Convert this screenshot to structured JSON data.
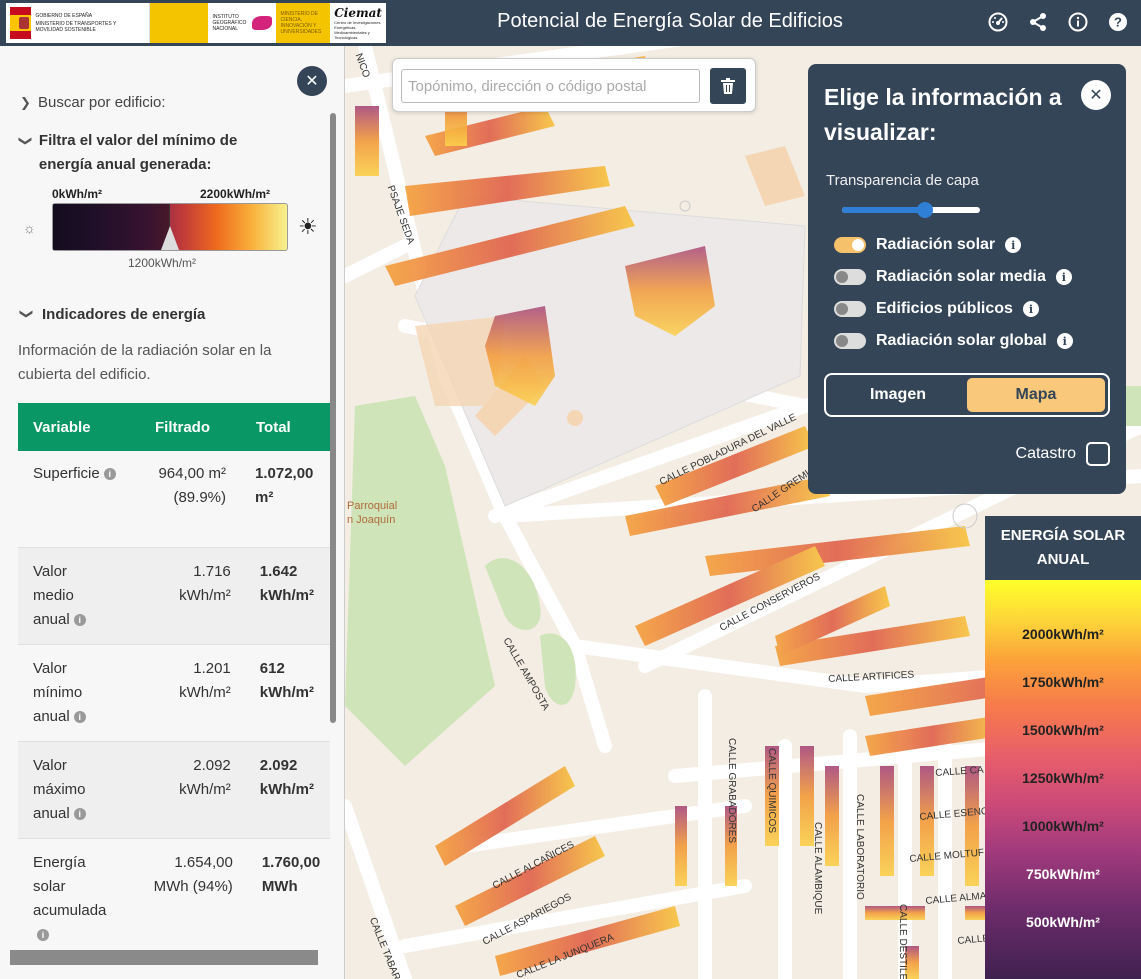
{
  "header": {
    "title": "Potencial de Energía Solar de Edificios",
    "logos": {
      "gov_line1": "GOBIERNO DE ESPAÑA",
      "gov_ministry": "MINISTERIO DE TRANSPORTES Y MOVILIDAD SOSTENIBLE",
      "ign": "INSTITUTO GEOGRÁFICO NACIONAL",
      "ministry2": "MINISTERIO DE CIENCIA, INNOVACIÓN Y UNIVERSIDADES",
      "ciemat": "Ciemat",
      "ciemat_sub": "Centro de Investigaciones Energéticas, Medioambientales y Tecnológicas"
    },
    "icons": [
      "dashboard-icon",
      "share-icon",
      "info-icon",
      "help-icon"
    ]
  },
  "sidebar": {
    "search_by_building": "Buscar por edificio:",
    "filter_title": "Filtra el valor del mínimo de energía anual generada:",
    "range_min": "0kWh/m²",
    "range_max": "2200kWh/m²",
    "range_value": "1200kWh/m²",
    "indicators_title": "Indicadores de energía",
    "indicators_desc": "Información de la radiación solar en la cubierta del edificio.",
    "table": {
      "headers": [
        "Variable",
        "Filtrado",
        "Total"
      ],
      "rows": [
        {
          "label": "Superficie",
          "filtered": "964,00 m² (89.9%)",
          "total": "1.072,00 m²"
        },
        {
          "label": "Valor medio anual",
          "filtered": "1.716 kWh/m²",
          "total": "1.642 kWh/m²"
        },
        {
          "label": "Valor mínimo anual",
          "filtered": "1.201 kWh/m²",
          "total": "612 kWh/m²"
        },
        {
          "label": "Valor máximo anual",
          "filtered": "2.092 kWh/m²",
          "total": "2.092 kWh/m²"
        },
        {
          "label": "Energía solar acumulada",
          "filtered": "1.654,00 MWh (94%)",
          "total": "1.760,00 MWh"
        }
      ]
    }
  },
  "map_search": {
    "placeholder": "Topónimo, dirección o código postal"
  },
  "panel": {
    "title": "Elige la información a visualizar:",
    "transparency_label": "Transparencia de capa",
    "transparency_value": 0.6,
    "layers": [
      {
        "label": "Radiación solar",
        "on": true
      },
      {
        "label": "Radiación solar media",
        "on": false
      },
      {
        "label": "Edificios públicos",
        "on": false
      },
      {
        "label": "Radiación solar global",
        "on": false
      }
    ],
    "view_modes": [
      "Imagen",
      "Mapa"
    ],
    "active_mode": "Mapa",
    "catastro_label": "Catastro"
  },
  "legend": {
    "title": "ENERGÍA SOLAR ANUAL",
    "labels": [
      "2000kWh/m²",
      "1750kWh/m²",
      "1500kWh/m²",
      "1250kWh/m²",
      "1000kWh/m²",
      "750kWh/m²",
      "500kWh/m²"
    ]
  },
  "map": {
    "streets": [
      "PSAJE SEDA",
      "CALLE POBLADURA DEL VALLE",
      "CALLE GREMIOS",
      "CALLE CONSERVEROS",
      "CALLE AMPOSTA",
      "CALLE ARTIFICES",
      "CALLE GRABADORES",
      "CALLE QUIMICOS",
      "CALLE ALAMBIQUE",
      "CALLE LABORATORIO",
      "CALLE DESTILE",
      "CALLE CA",
      "CALLE ESENC",
      "CALLE MOLTUF",
      "CALLE ALMA",
      "CALLE",
      "CALLE ALCAÑICES",
      "CALLE ASPARIEGOS",
      "CALLE LA JUNQUERA",
      "CALLE TABAR",
      "Parroquial",
      "n Joaquín",
      "NICO"
    ],
    "accent_colors": {
      "header": "#344558",
      "table_head": "#0a9766",
      "toggle_on": "#f5c26b"
    }
  }
}
